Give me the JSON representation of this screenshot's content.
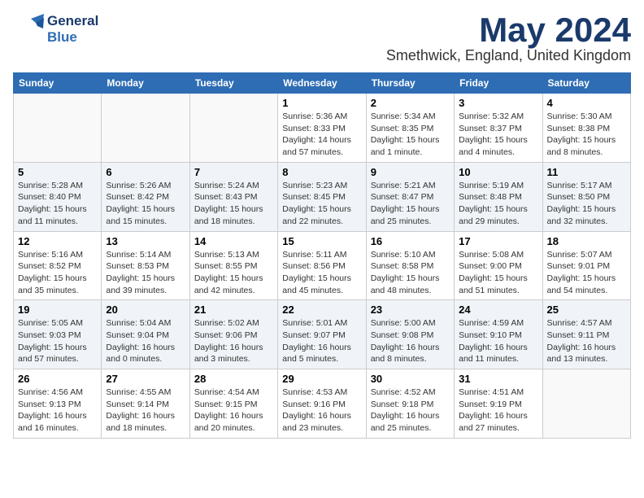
{
  "header": {
    "logo": {
      "general": "General",
      "blue": "Blue"
    },
    "title": "May 2024",
    "subtitle": "Smethwick, England, United Kingdom"
  },
  "days_of_week": [
    "Sunday",
    "Monday",
    "Tuesday",
    "Wednesday",
    "Thursday",
    "Friday",
    "Saturday"
  ],
  "weeks": [
    [
      {
        "day": "",
        "info": ""
      },
      {
        "day": "",
        "info": ""
      },
      {
        "day": "",
        "info": ""
      },
      {
        "day": "1",
        "info": "Sunrise: 5:36 AM\nSunset: 8:33 PM\nDaylight: 14 hours\nand 57 minutes."
      },
      {
        "day": "2",
        "info": "Sunrise: 5:34 AM\nSunset: 8:35 PM\nDaylight: 15 hours\nand 1 minute."
      },
      {
        "day": "3",
        "info": "Sunrise: 5:32 AM\nSunset: 8:37 PM\nDaylight: 15 hours\nand 4 minutes."
      },
      {
        "day": "4",
        "info": "Sunrise: 5:30 AM\nSunset: 8:38 PM\nDaylight: 15 hours\nand 8 minutes."
      }
    ],
    [
      {
        "day": "5",
        "info": "Sunrise: 5:28 AM\nSunset: 8:40 PM\nDaylight: 15 hours\nand 11 minutes."
      },
      {
        "day": "6",
        "info": "Sunrise: 5:26 AM\nSunset: 8:42 PM\nDaylight: 15 hours\nand 15 minutes."
      },
      {
        "day": "7",
        "info": "Sunrise: 5:24 AM\nSunset: 8:43 PM\nDaylight: 15 hours\nand 18 minutes."
      },
      {
        "day": "8",
        "info": "Sunrise: 5:23 AM\nSunset: 8:45 PM\nDaylight: 15 hours\nand 22 minutes."
      },
      {
        "day": "9",
        "info": "Sunrise: 5:21 AM\nSunset: 8:47 PM\nDaylight: 15 hours\nand 25 minutes."
      },
      {
        "day": "10",
        "info": "Sunrise: 5:19 AM\nSunset: 8:48 PM\nDaylight: 15 hours\nand 29 minutes."
      },
      {
        "day": "11",
        "info": "Sunrise: 5:17 AM\nSunset: 8:50 PM\nDaylight: 15 hours\nand 32 minutes."
      }
    ],
    [
      {
        "day": "12",
        "info": "Sunrise: 5:16 AM\nSunset: 8:52 PM\nDaylight: 15 hours\nand 35 minutes."
      },
      {
        "day": "13",
        "info": "Sunrise: 5:14 AM\nSunset: 8:53 PM\nDaylight: 15 hours\nand 39 minutes."
      },
      {
        "day": "14",
        "info": "Sunrise: 5:13 AM\nSunset: 8:55 PM\nDaylight: 15 hours\nand 42 minutes."
      },
      {
        "day": "15",
        "info": "Sunrise: 5:11 AM\nSunset: 8:56 PM\nDaylight: 15 hours\nand 45 minutes."
      },
      {
        "day": "16",
        "info": "Sunrise: 5:10 AM\nSunset: 8:58 PM\nDaylight: 15 hours\nand 48 minutes."
      },
      {
        "day": "17",
        "info": "Sunrise: 5:08 AM\nSunset: 9:00 PM\nDaylight: 15 hours\nand 51 minutes."
      },
      {
        "day": "18",
        "info": "Sunrise: 5:07 AM\nSunset: 9:01 PM\nDaylight: 15 hours\nand 54 minutes."
      }
    ],
    [
      {
        "day": "19",
        "info": "Sunrise: 5:05 AM\nSunset: 9:03 PM\nDaylight: 15 hours\nand 57 minutes."
      },
      {
        "day": "20",
        "info": "Sunrise: 5:04 AM\nSunset: 9:04 PM\nDaylight: 16 hours\nand 0 minutes."
      },
      {
        "day": "21",
        "info": "Sunrise: 5:02 AM\nSunset: 9:06 PM\nDaylight: 16 hours\nand 3 minutes."
      },
      {
        "day": "22",
        "info": "Sunrise: 5:01 AM\nSunset: 9:07 PM\nDaylight: 16 hours\nand 5 minutes."
      },
      {
        "day": "23",
        "info": "Sunrise: 5:00 AM\nSunset: 9:08 PM\nDaylight: 16 hours\nand 8 minutes."
      },
      {
        "day": "24",
        "info": "Sunrise: 4:59 AM\nSunset: 9:10 PM\nDaylight: 16 hours\nand 11 minutes."
      },
      {
        "day": "25",
        "info": "Sunrise: 4:57 AM\nSunset: 9:11 PM\nDaylight: 16 hours\nand 13 minutes."
      }
    ],
    [
      {
        "day": "26",
        "info": "Sunrise: 4:56 AM\nSunset: 9:13 PM\nDaylight: 16 hours\nand 16 minutes."
      },
      {
        "day": "27",
        "info": "Sunrise: 4:55 AM\nSunset: 9:14 PM\nDaylight: 16 hours\nand 18 minutes."
      },
      {
        "day": "28",
        "info": "Sunrise: 4:54 AM\nSunset: 9:15 PM\nDaylight: 16 hours\nand 20 minutes."
      },
      {
        "day": "29",
        "info": "Sunrise: 4:53 AM\nSunset: 9:16 PM\nDaylight: 16 hours\nand 23 minutes."
      },
      {
        "day": "30",
        "info": "Sunrise: 4:52 AM\nSunset: 9:18 PM\nDaylight: 16 hours\nand 25 minutes."
      },
      {
        "day": "31",
        "info": "Sunrise: 4:51 AM\nSunset: 9:19 PM\nDaylight: 16 hours\nand 27 minutes."
      },
      {
        "day": "",
        "info": ""
      }
    ]
  ]
}
